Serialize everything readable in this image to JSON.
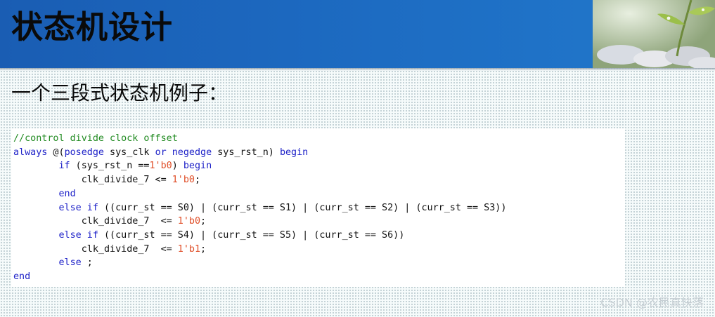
{
  "header": {
    "title": "状态机设计"
  },
  "subtitle": "一个三段式状态机例子：",
  "code": {
    "lines": [
      [
        {
          "cls": "c-comment",
          "text": "//control divide clock offset"
        }
      ],
      [
        {
          "cls": "c-kw",
          "text": "always"
        },
        {
          "cls": "",
          "text": " @("
        },
        {
          "cls": "c-kw",
          "text": "posedge"
        },
        {
          "cls": "",
          "text": " sys_clk "
        },
        {
          "cls": "c-kw",
          "text": "or"
        },
        {
          "cls": "",
          "text": " "
        },
        {
          "cls": "c-kw",
          "text": "negedge"
        },
        {
          "cls": "",
          "text": " sys_rst_n) "
        },
        {
          "cls": "c-kw",
          "text": "begin"
        }
      ],
      [
        {
          "cls": "",
          "text": "        "
        },
        {
          "cls": "c-kw",
          "text": "if"
        },
        {
          "cls": "",
          "text": " (sys_rst_n =="
        },
        {
          "cls": "c-num",
          "text": "1'b0"
        },
        {
          "cls": "",
          "text": ") "
        },
        {
          "cls": "c-kw",
          "text": "begin"
        }
      ],
      [
        {
          "cls": "",
          "text": "            clk_divide_7 <= "
        },
        {
          "cls": "c-num",
          "text": "1'b0"
        },
        {
          "cls": "",
          "text": ";"
        }
      ],
      [
        {
          "cls": "",
          "text": "        "
        },
        {
          "cls": "c-kw",
          "text": "end"
        }
      ],
      [
        {
          "cls": "",
          "text": "        "
        },
        {
          "cls": "c-kw",
          "text": "else if"
        },
        {
          "cls": "",
          "text": " ((curr_st == S0) | (curr_st == S1) | (curr_st == S2) | (curr_st == S3))"
        }
      ],
      [
        {
          "cls": "",
          "text": "            clk_divide_7  <= "
        },
        {
          "cls": "c-num",
          "text": "1'b0"
        },
        {
          "cls": "",
          "text": ";"
        }
      ],
      [
        {
          "cls": "",
          "text": "        "
        },
        {
          "cls": "c-kw",
          "text": "else if"
        },
        {
          "cls": "",
          "text": " ((curr_st == S4) | (curr_st == S5) | (curr_st == S6))"
        }
      ],
      [
        {
          "cls": "",
          "text": "            clk_divide_7  <= "
        },
        {
          "cls": "c-num",
          "text": "1'b1"
        },
        {
          "cls": "",
          "text": ";"
        }
      ],
      [
        {
          "cls": "",
          "text": "        "
        },
        {
          "cls": "c-kw",
          "text": "else"
        },
        {
          "cls": "",
          "text": " ;"
        }
      ],
      [
        {
          "cls": "c-kw",
          "text": "end"
        }
      ]
    ]
  },
  "watermark": "CSDN @农民真快落",
  "colors": {
    "header_blue": "#1c68bf",
    "keyword": "#1e22c8",
    "comment": "#228b22",
    "number": "#e0502a"
  }
}
